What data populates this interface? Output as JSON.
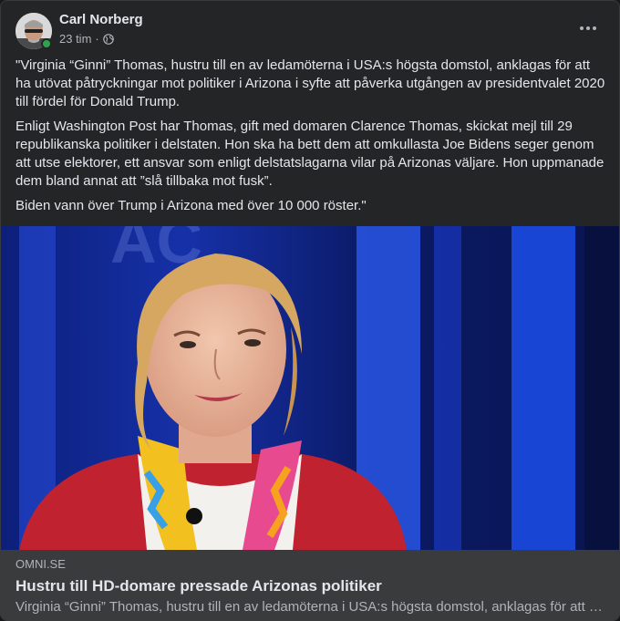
{
  "post": {
    "author": "Carl Norberg",
    "time": "23 tim",
    "separator": "·",
    "privacy_icon": "globe-icon",
    "more_icon": "more-horizontal-icon",
    "paragraphs": [
      "\"Virginia “Ginni” Thomas, hustru till en av ledamöterna i USA:s högsta domstol, anklagas för att ha utövat påtryckningar mot politiker i Arizona i syfte att påverka utgången av presidentvalet 2020 till fördel för Donald Trump.",
      "Enligt Washington Post har Thomas, gift med domaren Clarence Thomas, skickat mejl till 29 republikanska politiker i delstaten. Hon ska ha bett dem att omkullasta Joe Bidens seger genom att utse elektorer, ett ansvar som enligt delstatslagarna vilar på Arizonas väljare. Hon uppmanade dem bland annat att ”slå tillbaka mot fusk”.",
      "Biden vann över Trump i Arizona med över 10 000 röster.\""
    ]
  },
  "link_preview": {
    "domain": "OMNI.SE",
    "title": "Hustru till HD-domare pressade Arizonas politiker",
    "description": "Virginia “Ginni” Thomas, hustru till en av ledamöterna i USA:s högsta domstol, anklagas för att ha utövat påtryckningar mot politiker i Arizona"
  },
  "colors": {
    "card_bg": "#242526",
    "link_info_bg": "#3a3b3c",
    "online": "#31a24c",
    "primary_text": "#e4e6eb",
    "secondary_text": "#b0b3b8"
  }
}
